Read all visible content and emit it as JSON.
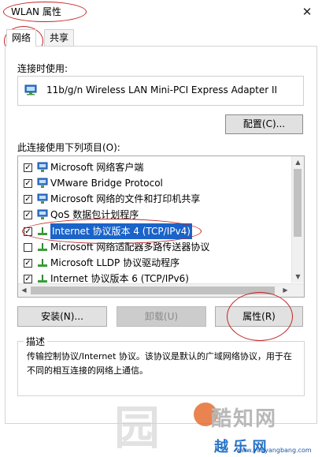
{
  "window": {
    "title": "WLAN 属性",
    "close_glyph": "✕"
  },
  "tabs": [
    {
      "label": "网络",
      "active": true
    },
    {
      "label": "共享",
      "active": false
    }
  ],
  "connect_using": {
    "label": "连接时使用:",
    "adapter_name": "11b/g/n  Wireless LAN Mini-PCI Express Adapter II",
    "configure_label": "配置(C)..."
  },
  "items_section": {
    "label": "此连接使用下列项目(O):",
    "items": [
      {
        "label": "Microsoft 网络客户端",
        "checked": true,
        "icon": "network-client-icon"
      },
      {
        "label": "VMware Bridge Protocol",
        "checked": true,
        "icon": "network-client-icon"
      },
      {
        "label": "Microsoft 网络的文件和打印机共享",
        "checked": true,
        "icon": "network-client-icon"
      },
      {
        "label": "QoS 数据包计划程序",
        "checked": true,
        "icon": "network-client-icon"
      },
      {
        "label": "Internet 协议版本 4 (TCP/IPv4)",
        "checked": true,
        "icon": "protocol-icon",
        "selected": true
      },
      {
        "label": "Microsoft 网络适配器多路传送器协议",
        "checked": false,
        "icon": "protocol-icon"
      },
      {
        "label": "Microsoft LLDP 协议驱动程序",
        "checked": true,
        "icon": "protocol-icon"
      },
      {
        "label": "Internet 协议版本 6 (TCP/IPv6)",
        "checked": true,
        "icon": "protocol-icon"
      }
    ]
  },
  "buttons": {
    "install": "安装(N)...",
    "uninstall": "卸载(U)",
    "properties": "属性(R)"
  },
  "description": {
    "title": "描述",
    "text": "传输控制协议/Internet 协议。该协议是默认的广域网络协议，用于在不同的相互连接的网络上通信。"
  },
  "watermark": {
    "site_cn": "酷知网",
    "brand": "越 乐 网",
    "url": "www.yueyangbang.com",
    "ghost": "园"
  },
  "colors": {
    "selection": "#1a63c9",
    "annotation": "#c12525"
  }
}
